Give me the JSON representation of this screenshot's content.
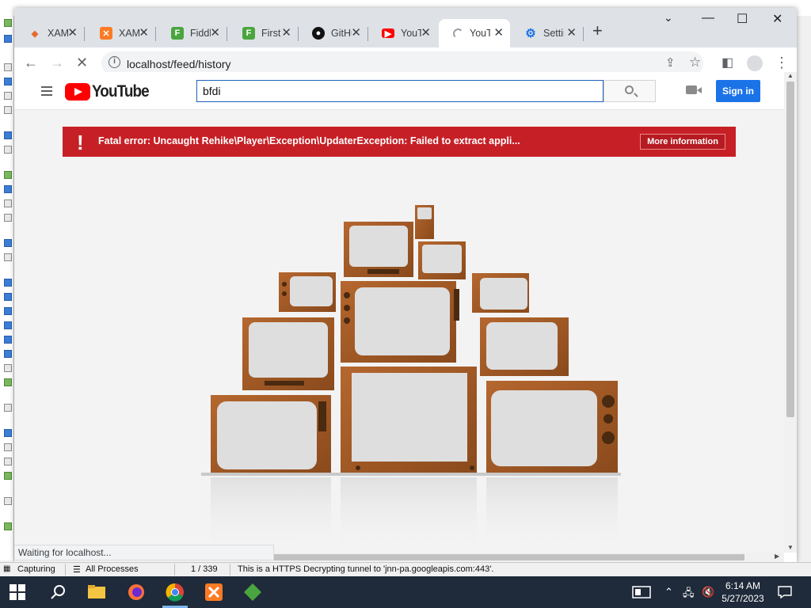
{
  "browser": {
    "tabs": [
      {
        "label": "XAMPP",
        "favicon": "xampp-icon",
        "color": "#e86a2b"
      },
      {
        "label": "XAMPP",
        "favicon": "xampp-icon",
        "color": "#fb7a24"
      },
      {
        "label": "Fiddler",
        "favicon": "fiddler-icon",
        "color": "#4aa53f"
      },
      {
        "label": "First",
        "favicon": "fiddler-icon",
        "color": "#4aa53f"
      },
      {
        "label": "GitHub",
        "favicon": "github-icon",
        "color": "#111111"
      },
      {
        "label": "YouTube",
        "favicon": "youtube-icon",
        "color": "#ff0000"
      },
      {
        "label": "YouTube",
        "favicon": "loading-spinner-icon",
        "color": "#9aa0a6"
      },
      {
        "label": "Settings",
        "favicon": "gear-icon",
        "color": "#1a73e8"
      }
    ],
    "active_tab_index": 6,
    "url": "localhost/feed/history",
    "status_bubble": "Waiting for localhost..."
  },
  "youtube": {
    "logo_text": "YouTube",
    "search_value": "bfdi",
    "sign_in_label": "Sign in",
    "error_message": "Fatal error: Uncaught Rehike\\Player\\Exception\\UpdaterException: Failed to extract appli...",
    "error_mark": "!",
    "more_info_label": "More information"
  },
  "fiddler": {
    "capturing": "Capturing",
    "processes": "All Processes",
    "count": "1 / 339",
    "message": "This is a HTTPS Decrypting tunnel to 'jnn-pa.googleapis.com:443'."
  },
  "taskbar": {
    "time": "6:14 AM",
    "date": "5/27/2023"
  },
  "colors": {
    "error_red": "#c62026",
    "signin_blue": "#1b73e8",
    "youtube_red": "#ff0000"
  }
}
